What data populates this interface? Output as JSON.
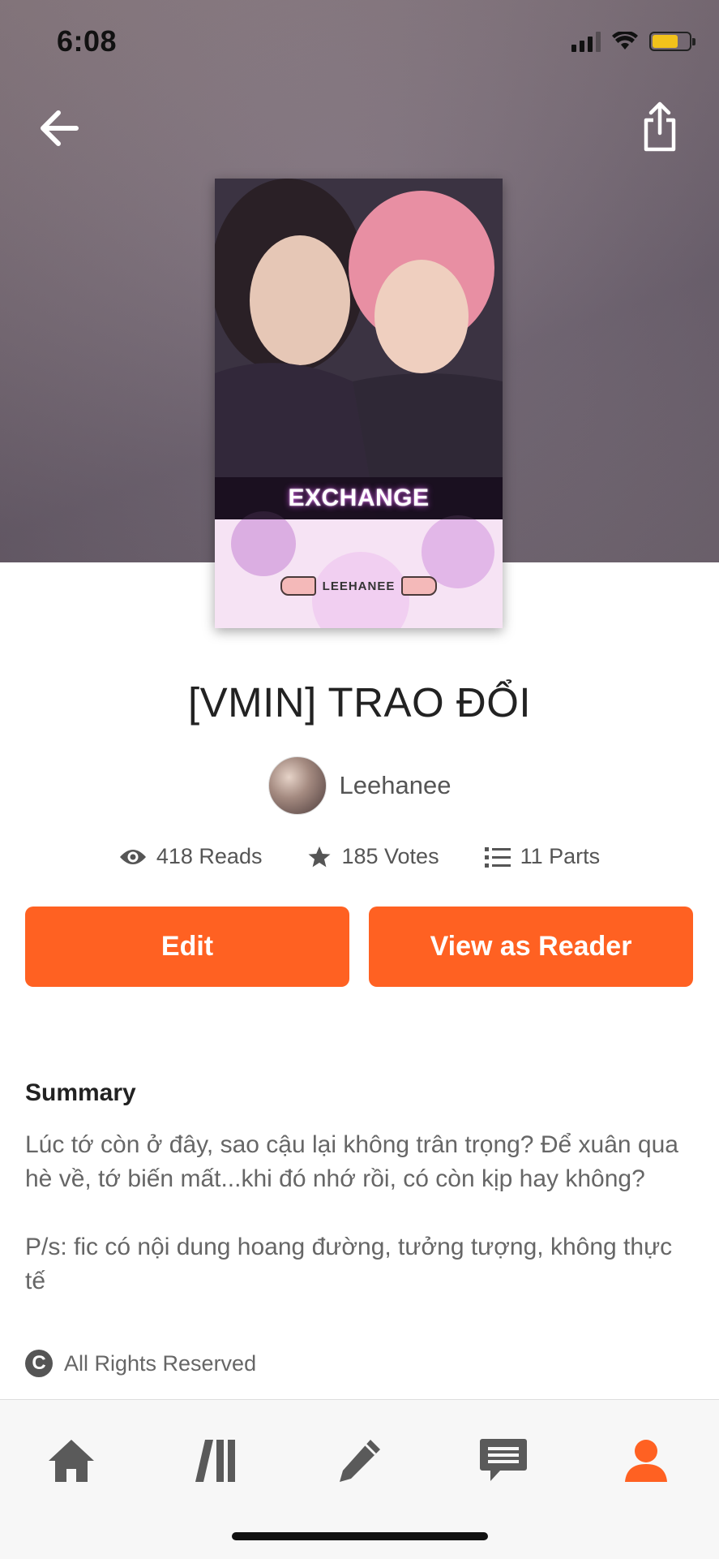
{
  "status_bar": {
    "time": "6:08"
  },
  "header": {
    "back_icon": "arrow-left-icon",
    "share_icon": "share-icon"
  },
  "cover": {
    "title": "EXCHANGE",
    "author": "LEEHANEE"
  },
  "story": {
    "title": "[VMIN] TRAO ĐỔI",
    "author": "Leehanee",
    "stats": {
      "reads": "418 Reads",
      "votes": "185 Votes",
      "parts": "11 Parts"
    }
  },
  "actions": {
    "edit_label": "Edit",
    "reader_label": "View as Reader"
  },
  "summary": {
    "heading": "Summary",
    "paragraph1": "Lúc tớ còn ở đây, sao cậu lại không trân trọng? Để xuân qua hè về, tớ biến mất...khi đó nhớ rồi, có còn kịp hay không?",
    "paragraph2": "P/s: fic có nội dung hoang đường, tưởng tượng, không thực tế"
  },
  "license": {
    "symbol": "C",
    "label": "All Rights Reserved"
  },
  "bottom_nav": {
    "items": [
      {
        "icon": "home-icon",
        "active": false
      },
      {
        "icon": "library-icon",
        "active": false
      },
      {
        "icon": "write-pencil-icon",
        "active": false
      },
      {
        "icon": "messages-icon",
        "active": false
      },
      {
        "icon": "profile-icon",
        "active": true
      }
    ]
  },
  "colors": {
    "accent": "#ff6122",
    "nav_inactive": "#5a5a5a",
    "nav_active": "#ff6122"
  }
}
